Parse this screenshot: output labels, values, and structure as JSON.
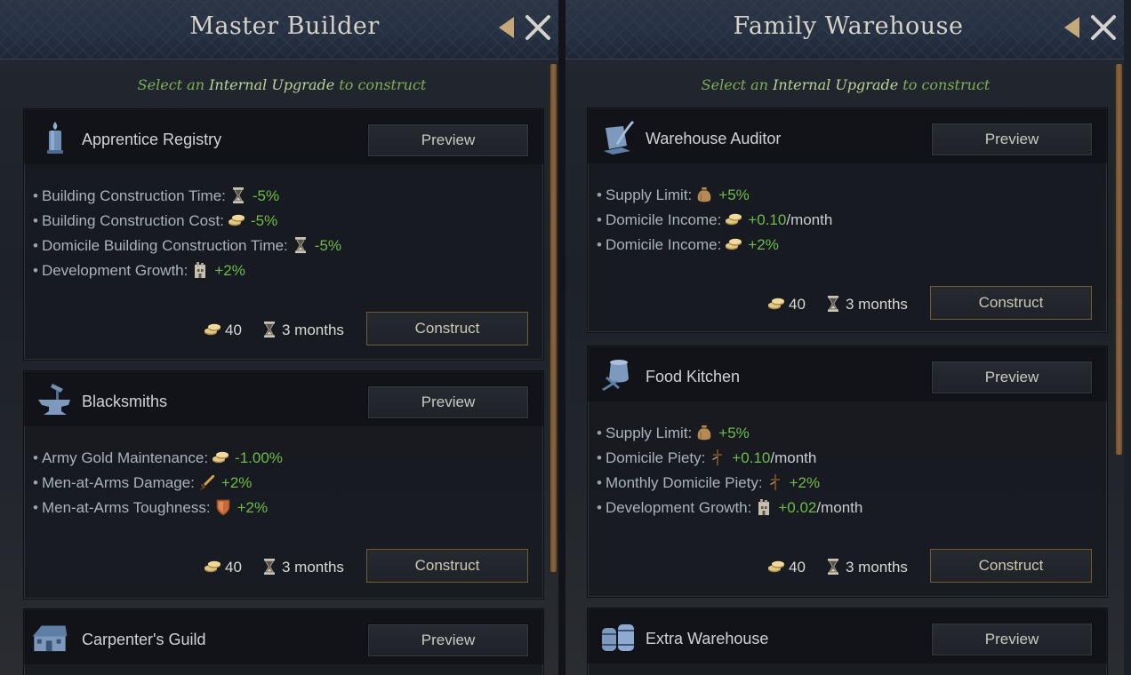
{
  "left": {
    "title": "Master Builder",
    "subtitle": {
      "pre": "Select an",
      "highlight": "Internal Upgrade",
      "post": "to construct"
    },
    "cards": [
      {
        "name": "Apprentice Registry",
        "preview_label": "Preview",
        "construct_label": "Construct",
        "icon": "candle-icon",
        "effects": [
          {
            "label": "Building Construction Time:",
            "icon": "hourglass-icon",
            "value": "-5%",
            "unit": ""
          },
          {
            "label": "Building Construction Cost:",
            "icon": "gold-coins-icon",
            "value": "-5%",
            "unit": ""
          },
          {
            "label": "Domicile Building Construction Time:",
            "icon": "hourglass-icon",
            "value": "-5%",
            "unit": ""
          },
          {
            "label": "Development Growth:",
            "icon": "development-icon",
            "value": "+2%",
            "unit": ""
          }
        ],
        "cost_gold": "40",
        "cost_time": "3 months"
      },
      {
        "name": "Blacksmiths",
        "preview_label": "Preview",
        "construct_label": "Construct",
        "icon": "anvil-icon",
        "effects": [
          {
            "label": "Army Gold Maintenance:",
            "icon": "gold-coins-icon",
            "value": "-1.00%",
            "unit": ""
          },
          {
            "label": "Men-at-Arms Damage:",
            "icon": "sword-icon",
            "value": "+2%",
            "unit": ""
          },
          {
            "label": "Men-at-Arms Toughness:",
            "icon": "shield-icon",
            "value": "+2%",
            "unit": ""
          }
        ],
        "cost_gold": "40",
        "cost_time": "3 months"
      },
      {
        "name": "Carpenter's Guild",
        "preview_label": "Preview",
        "icon": "house-icon"
      }
    ]
  },
  "right": {
    "title": "Family Warehouse",
    "subtitle": {
      "pre": "Select an",
      "highlight": "Internal Upgrade",
      "post": "to construct"
    },
    "cards": [
      {
        "name": "Warehouse Auditor",
        "preview_label": "Preview",
        "construct_label": "Construct",
        "icon": "quill-scroll-icon",
        "effects": [
          {
            "label": "Supply Limit:",
            "icon": "supply-sack-icon",
            "value": "+5%",
            "unit": ""
          },
          {
            "label": "Domicile Income:",
            "icon": "gold-coins-icon",
            "value": "+0.10",
            "unit": "/month"
          },
          {
            "label": "Domicile Income:",
            "icon": "gold-coins-icon",
            "value": "+2%",
            "unit": ""
          }
        ],
        "cost_gold": "40",
        "cost_time": "3 months"
      },
      {
        "name": "Food Kitchen",
        "preview_label": "Preview",
        "construct_label": "Construct",
        "icon": "cooking-pot-icon",
        "effects": [
          {
            "label": "Supply Limit:",
            "icon": "supply-sack-icon",
            "value": "+5%",
            "unit": ""
          },
          {
            "label": "Domicile Piety:",
            "icon": "piety-icon",
            "value": "+0.10",
            "unit": "/month"
          },
          {
            "label": "Monthly Domicile Piety:",
            "icon": "piety-icon",
            "value": "+2%",
            "unit": ""
          },
          {
            "label": "Development Growth:",
            "icon": "development-icon",
            "value": "+0.02",
            "unit": "/month"
          }
        ],
        "cost_gold": "40",
        "cost_time": "3 months"
      },
      {
        "name": "Extra Warehouse",
        "preview_label": "Preview",
        "icon": "barrels-icon"
      }
    ]
  },
  "colors": {
    "positive": "#6fbb4a",
    "subtitle": "#7fae5b",
    "construct_border": "#6b5a3d",
    "scrollbar": "#8c6642"
  }
}
